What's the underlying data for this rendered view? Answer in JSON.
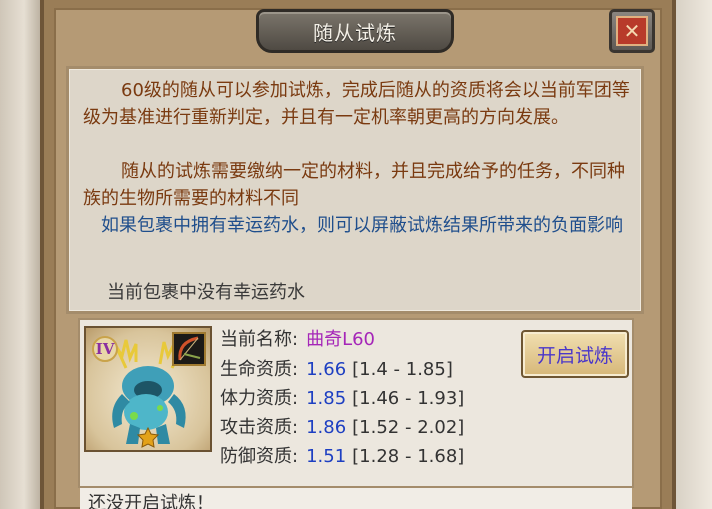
{
  "dialog": {
    "title": "随从试炼",
    "close_icon": "close-icon"
  },
  "info": {
    "p1": "60级的随从可以参加试炼，完成后随从的资质将会以当前军团等级为基准进行重新判定，并且有一定机率朝更高的方向发展。",
    "p2": "随从的试炼需要缴纳一定的材料，并且完成给予的任务，不同种族的生物所需要的材料不同",
    "p3": "如果包裹中拥有幸运药水，则可以屏蔽试炼结果所带来的负面影响",
    "p4": "当前包裹中没有幸运药水"
  },
  "pet": {
    "rank": "IV",
    "name_label": "当前名称:",
    "name": "曲奇L60",
    "stats": [
      {
        "label": "生命资质:",
        "value": "1.66",
        "range": "[1.4 - 1.85]"
      },
      {
        "label": "体力资质:",
        "value": "1.85",
        "range": "[1.46 - 1.93]"
      },
      {
        "label": "攻击资质:",
        "value": "1.86",
        "range": "[1.52 - 2.02]"
      },
      {
        "label": "防御资质:",
        "value": "1.51",
        "range": "[1.28 - 1.68]"
      }
    ],
    "start_button": "开启试炼"
  },
  "status": {
    "text": "还没开启试炼！"
  },
  "colors": {
    "frame": "#9a7d57",
    "panel": "#ddd6c9",
    "text_brown": "#7a3a10",
    "text_blue": "#1f4e8c",
    "name_purple": "#a526b8",
    "value_blue": "#1d3fc2"
  }
}
